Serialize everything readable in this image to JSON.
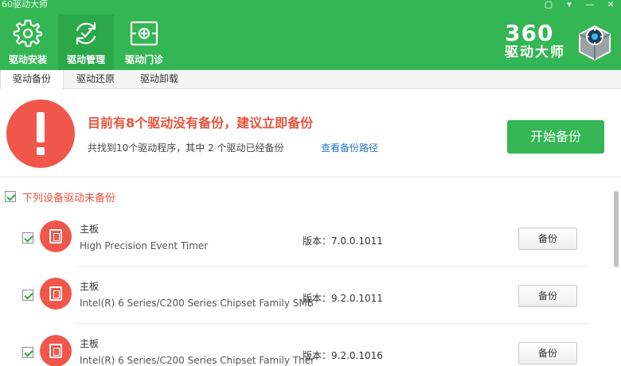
{
  "window": {
    "title": "60驱动大师",
    "controls": [
      "▢",
      "▾",
      "—",
      "✕"
    ]
  },
  "nav": [
    {
      "label": "驱动安装",
      "icon": "gear-icon",
      "active": false
    },
    {
      "label": "驱动管理",
      "icon": "refresh-icon",
      "active": true
    },
    {
      "label": "驱动门诊",
      "icon": "medical-kit-icon",
      "active": false
    }
  ],
  "logo": {
    "number": "360",
    "name": "驱动大师"
  },
  "subtabs": [
    {
      "label": "驱动备份",
      "active": true
    },
    {
      "label": "驱动还原",
      "active": false
    },
    {
      "label": "驱动卸载",
      "active": false
    }
  ],
  "alert": {
    "title": "目前有8个驱动没有备份，建议立即备份",
    "subtitle": "共找到10个驱动程序，其中 2 个驱动已经备份",
    "link": "查看备份路径",
    "start_button": "开始备份"
  },
  "section": {
    "label": "下列设备驱动未备份",
    "checked": true
  },
  "devices": [
    {
      "name": "主板",
      "desc": "High Precision Event Timer",
      "version": "版本：7.0.0.1011",
      "button": "备份",
      "checked": true
    },
    {
      "name": "主板",
      "desc": "Intel(R) 6 Series/C200 Series Chipset Family SMB",
      "version": "版本：9.2.0.1011",
      "button": "备份",
      "checked": true
    },
    {
      "name": "主板",
      "desc": "Intel(R) 6 Series/C200 Series Chipset Family Ther",
      "version": "版本：9.2.0.1016",
      "button": "备份",
      "checked": true
    }
  ],
  "colors": {
    "brand_green": "#33b653",
    "alert_red": "#f0574a",
    "link_blue": "#2b77c7"
  }
}
